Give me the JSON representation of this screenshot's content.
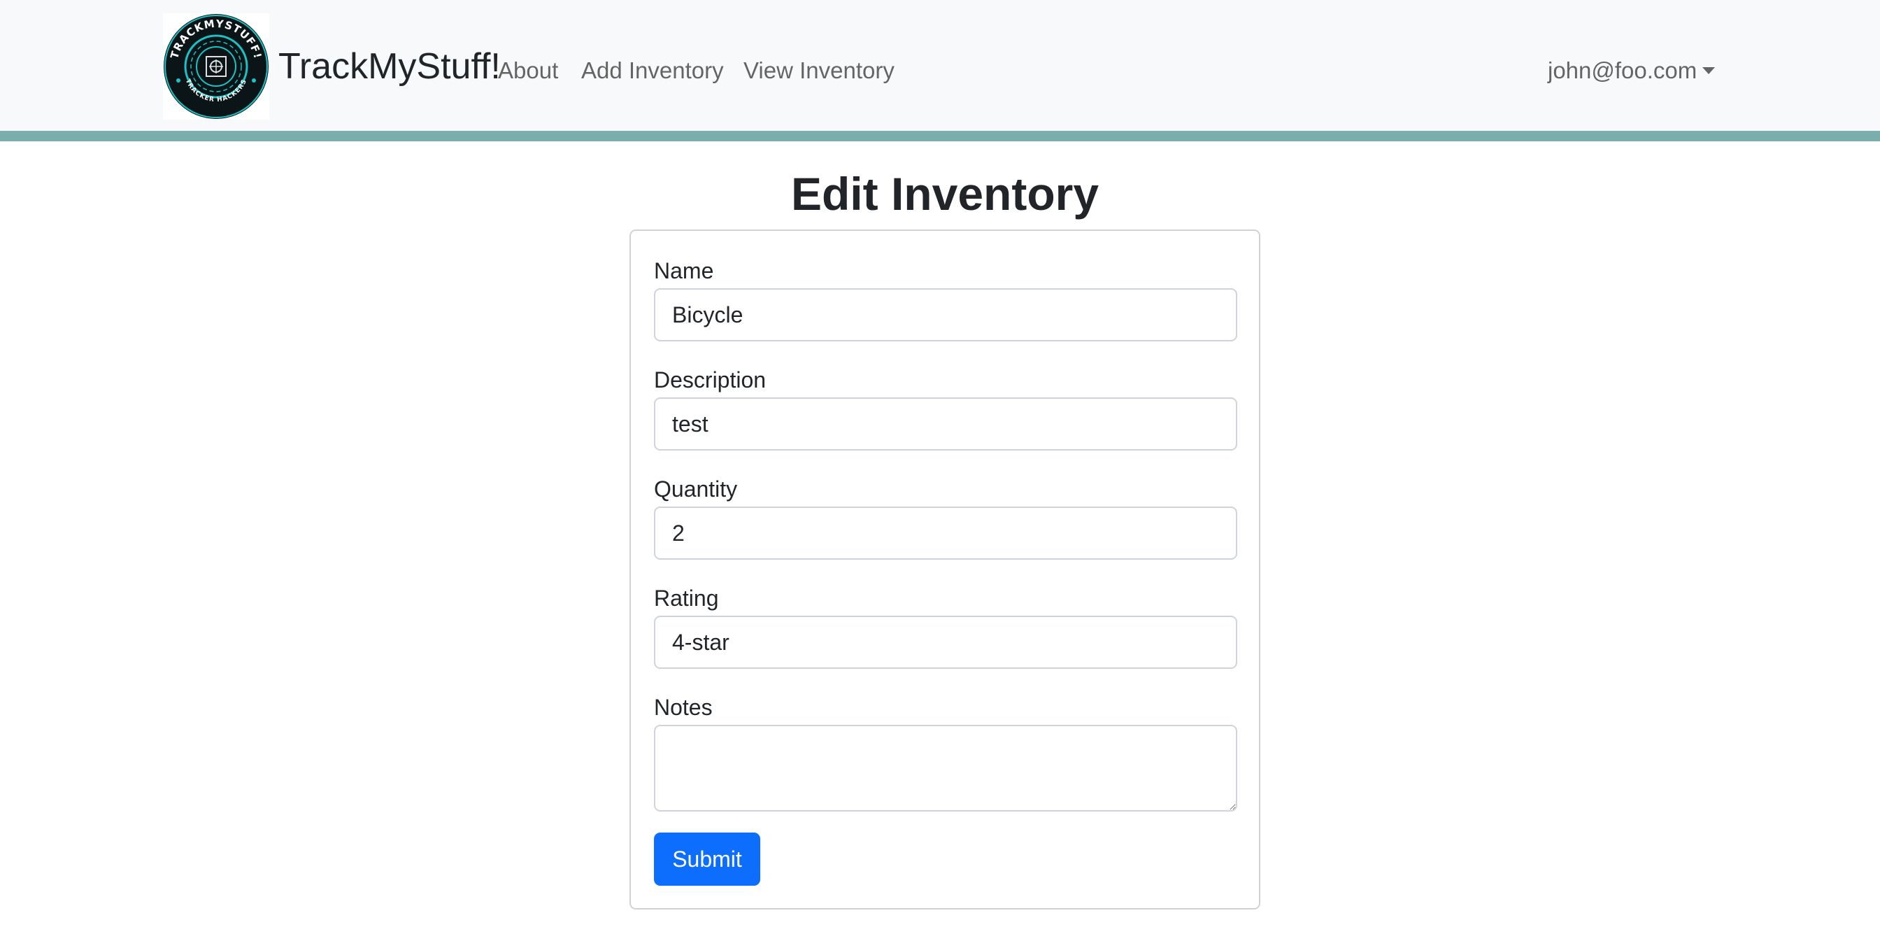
{
  "app": {
    "brand_name": "TrackMyStuff!",
    "logo_text_top": "TRACKMYSTUFF!",
    "logo_text_bottom": "TRACKER HACKERS"
  },
  "nav": {
    "links": [
      {
        "label": "About"
      },
      {
        "label": "Add Inventory"
      },
      {
        "label": "View Inventory"
      }
    ],
    "user_email": "john@foo.com"
  },
  "page": {
    "title": "Edit Inventory"
  },
  "form": {
    "fields": [
      {
        "label": "Name",
        "value": "Bicycle"
      },
      {
        "label": "Description",
        "value": "test"
      },
      {
        "label": "Quantity",
        "value": "2"
      },
      {
        "label": "Rating",
        "value": "4-star"
      },
      {
        "label": "Notes",
        "value": ""
      }
    ],
    "submit_label": "Submit"
  },
  "colors": {
    "navbar_bg": "#f8f9fa",
    "accent_bar": "#7aaeae",
    "primary": "#0d6efd",
    "logo_cyan": "#19c3c7"
  }
}
